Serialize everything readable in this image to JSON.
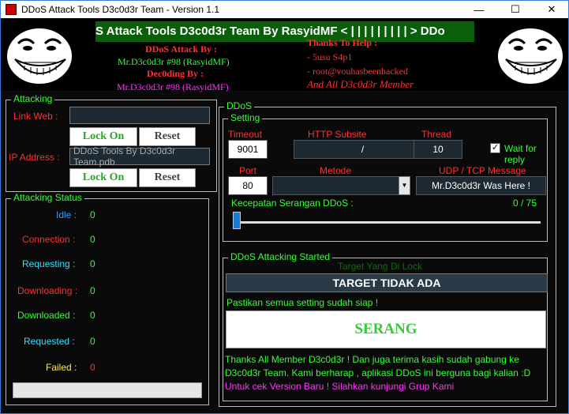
{
  "window": {
    "title": "DDoS Attack Tools D3c0d3r Team - Version 1.1",
    "minimize": "—",
    "maximize": "☐",
    "close": "✕"
  },
  "banner": {
    "marquee": "S Attack Tools D3c0d3r Team By RasyidMF < | | | | | | | | | > DDo",
    "attack_by_label": "DDoS Attack By :",
    "attack_by_value": "Mr.D3c0d3r #98 (RasyidMF)",
    "decoding_label": "Dec0ding By :",
    "decoding_value": "Mr.D3c0d3r #98 (RasyidMF)",
    "thanks_label": "Thanks To Help :",
    "thanks_1": "- 5usu S4p1",
    "thanks_2": "- root@vouhasbeenhacked",
    "thanks_3": "And All D3c0d3r Member"
  },
  "attacking": {
    "title": "Attacking",
    "link_label": "Link Web :",
    "link_value": "",
    "ip_label": "IP Address :",
    "ip_value": "DDoS Tools By D3c0d3r Team.pdb",
    "lock_on": "Lock On",
    "reset": "Reset"
  },
  "status": {
    "title": "Attacking Status",
    "items": [
      {
        "label": "Idle :",
        "value": "0"
      },
      {
        "label": "Connection :",
        "value": "0"
      },
      {
        "label": "Requesting :",
        "value": "0"
      },
      {
        "label": "Downloading :",
        "value": "0"
      },
      {
        "label": "Downloaded :",
        "value": "0"
      },
      {
        "label": "Requested :",
        "value": "0"
      },
      {
        "label": "Failed :",
        "value": "0"
      }
    ]
  },
  "ddos": {
    "title": "DDoS",
    "setting_title": "Setting",
    "timeout_label": "Timeout",
    "timeout_value": "9001",
    "subsite_label": "HTTP Subsite",
    "subsite_value": "/",
    "thread_label": "Thread",
    "thread_value": "10",
    "wait_label": "Wait for reply",
    "wait_checked": true,
    "port_label": "Port",
    "port_value": "80",
    "metode_label": "Metode",
    "metode_value": "",
    "udp_label": "UDP / TCP Message",
    "udp_value": "Mr.D3c0d3r Was Here !",
    "speed_label": "Kecepatan Serangan DDoS :",
    "speed_value": "0 / 75",
    "speed_level": 0
  },
  "started": {
    "title": "DDoS Attacking Started",
    "target_label": "Target Yang Di Lock",
    "target_value": "TARGET TIDAK ADA",
    "ready_text": "Pastikan semua setting sudah siap !",
    "attack_button": "SERANG",
    "thanks_text": "Thanks All Member D3c0d3r ! Dan juga terima kasih sudah gabung ke D3c0d3r Team. Kami berharap , aplikasi DDoS ini berguna bagi kalian :D",
    "version_text": " Untuk cek Version Baru ! Silahkan kunjungi Grup Kami"
  },
  "colors": {
    "green": "#33ff33",
    "red": "#ff3030",
    "cyan": "#33ddff",
    "yellow": "#ffee33",
    "magenta": "#ff33ff",
    "blue": "#3399ff"
  }
}
